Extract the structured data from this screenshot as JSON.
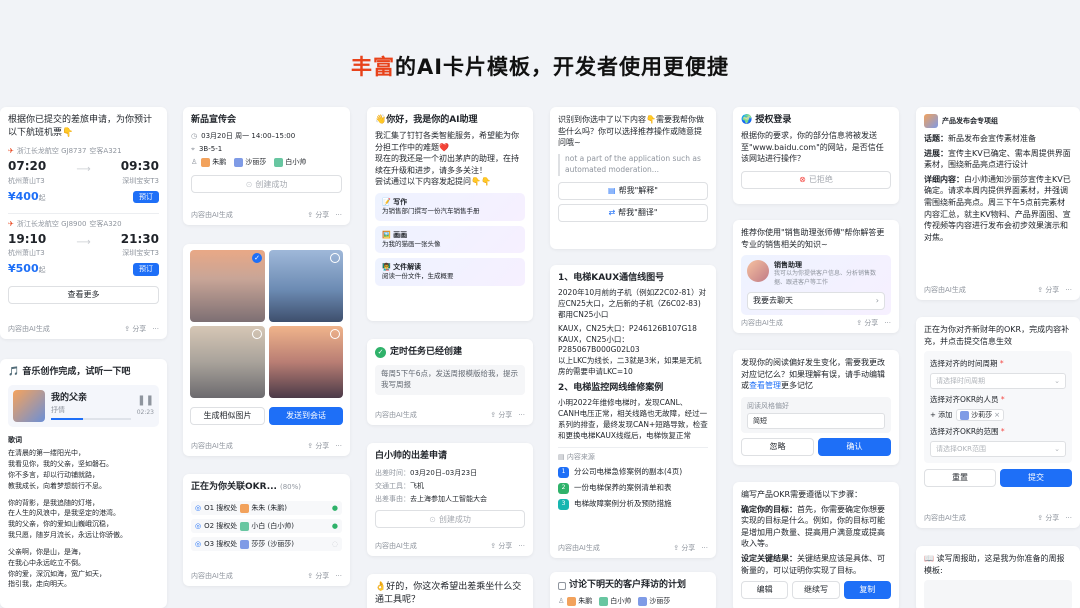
{
  "headline": {
    "highlight": "丰富",
    "rest": "的AI卡片模板，开发者使用更便捷"
  },
  "footer": {
    "src": "内容由AI生成",
    "share": "分享",
    "more": "···"
  },
  "travel": {
    "question": "根据你已提交的差旅申请，为你预计以下航班机票👇",
    "flights": [
      {
        "airline": "浙江长龙航空 GJ8737",
        "plane": "空客A321",
        "dep_time": "07:20",
        "arr_time": "09:30",
        "dep_airport": "杭州萧山T3",
        "arr_airport": "深圳宝安T3",
        "price": "¥400",
        "price_note": "起",
        "action": "预订"
      },
      {
        "airline": "浙江长龙航空 GJ8900",
        "plane": "空客A320",
        "dep_time": "19:10",
        "arr_time": "21:30",
        "dep_airport": "杭州萧山T3",
        "arr_airport": "深圳宝安T3",
        "price": "¥500",
        "price_note": "起",
        "action": "预订"
      }
    ],
    "more": "查看更多"
  },
  "music": {
    "title": "🎵 音乐创作完成，试听一下吧",
    "song": "我的父亲",
    "artist": "抒情",
    "elapsed": "00:00",
    "total": "02:23",
    "lyrics_title": "歌词",
    "lyrics": [
      "在清晨的第一缕阳光中，",
      "我看见你，我的父亲，坚如磐石。",
      "你不多言，却以行动铺就路，",
      "教我成长，向着梦想前行不息。",
      "",
      "你的背影，是我追随的灯塔，",
      "在人生的风浪中，是我坚定的港湾。",
      "我的父亲，你的爱如山巍峨沉稳，",
      "我只愿，随岁月流长，永远让你骄傲。",
      "",
      "父亲啊，你是山，是海，",
      "在我心中永远屹立不倒。",
      "你的爱，深沉如海，宽广如天，",
      "指引我，走向明天。"
    ]
  },
  "meeting": {
    "title": "新品宣传会",
    "time": "03月20日 周一 14:00–15:00",
    "room": "3B-5-1",
    "people": [
      "朱鹏",
      "沙丽莎",
      "白小帅"
    ],
    "status": "创建成功"
  },
  "images": {
    "btn_generate": "生成相似图片",
    "btn_send": "发送到会话"
  },
  "okr_link": {
    "title": "正在为你关联OKR...",
    "progress": "(80%)",
    "rows": [
      {
        "title": "O1 搜权处",
        "owner": "朱朱 (朱鹏)",
        "state": "done"
      },
      {
        "title": "O2 搜权处",
        "owner": "小白 (白小帅)",
        "state": "done"
      },
      {
        "title": "O3 搜权处",
        "owner": "莎莎 (沙丽莎)",
        "state": "loading"
      }
    ]
  },
  "assistant": {
    "greeting": "👋你好，我是你的AI助理",
    "intro": "我汇集了钉钉各类智能服务，希望能为你分担工作中的难题❤️",
    "intro2": "现在的我还是一个初出茅庐的助理，在持续在升级和进步，请多多关注！",
    "intro3": "尝试通过以下内容发起提问👇👇",
    "items": [
      {
        "icon": "📝",
        "title": "写作",
        "desc": "为销售部门撰写一份汽车销售手册"
      },
      {
        "icon": "🖼️",
        "title": "画画",
        "desc": "为我的猫画一张头像"
      },
      {
        "icon": "👨‍🏫",
        "title": "文件解读",
        "desc": "阅读一份文件，生成概要"
      }
    ]
  },
  "task": {
    "title": "定时任务已经创建",
    "desc": "每周5下午6点，发送周报模版给我，提示我写周报"
  },
  "trip": {
    "title": "白小帅的出差申请",
    "rows": [
      {
        "k": "出差时间：",
        "v": "03月20日–03月23日"
      },
      {
        "k": "交通工具：",
        "v": "飞机"
      },
      {
        "k": "出差事由：",
        "v": "去上海参加人工智能大会"
      }
    ],
    "status": "创建成功"
  },
  "transport": {
    "text": "👌好的，你这次希望出差乘坐什么交通工具呢？"
  },
  "recognize": {
    "text": "识别到你选中了以下内容👇需要我帮你做些什么吗？你可以选择推荐操作或随意提问哦~",
    "quote": "not a part of the application such as automated moderation...",
    "actions": [
      "帮我\"解释\"",
      "帮我\"翻译\""
    ]
  },
  "fault": {
    "h1": "1、电梯KAUX通信线图号",
    "p1": "2020年10月前的子机（例如Z2C02-81）对应CN25大口，之后新的子机（Z6C02-83)都用CN25小口",
    "p2": "KAUX，CN25大口：P246126B107G18",
    "p3": "KAUX，CN25小口：P285067B000G02L03",
    "p4": "以上LKC为线长，二3就是3米，如果是无机房的需要申请LKC=10",
    "h2": "2、电梯监控网线维修案例",
    "p5": "小明2022年维修电梯时，发现CANL、CANH电压正常，相关线路也无故障，经过一系列的排查，最终发现CAN+短路导致，检查和更换电梯KAUX线缆后，电梯恢复正常",
    "sources_title": "内容来源",
    "sources": [
      "分公司电梯急修案例的副本(4页)",
      "一份电梯保养的案例清单和表",
      "电梯故障案例分析及预防措施"
    ]
  },
  "plan": {
    "title": "讨论下明天的客户拜访的计划",
    "people": [
      "朱鹏",
      "白小帅",
      "沙丽莎"
    ]
  },
  "auth": {
    "title": "🌍 授权登录",
    "text": "根据你的要求，你的部分信息将被发送至\"www.baidu.com\"的网站，是否信任该网站进行操作？",
    "status": "已拒绝"
  },
  "sales": {
    "text": "推荐你使用\"销售助理张师傅\"帮你解答更专业的销售相关的知识~",
    "name": "销售助理",
    "desc": "我可以为你提供客户信息、分析销售数据、跟进客户等工作",
    "cta": "我要去聊天"
  },
  "reading": {
    "text": "发现你的阅读偏好发生变化，需要我更改对应记忆么？如果理解有误，请手动编辑或",
    "link": "查看管理",
    "text2": "更多记忆",
    "label": "阅读风格偏好",
    "value": "简短",
    "ignore": "忽略",
    "confirm": "确认"
  },
  "okr_steps": {
    "intro": "编写产品OKR需要遵循以下步骤：",
    "s1k": "确定你的目标：",
    "s1": "首先，你需要确定你想要实现的目标是什么。例如，你的目标可能是增加用户数量、提高用户满意度或提高收入等。",
    "s2k": "设定关键结果：",
    "s2": "关键结果应该是具体、可衡量的，可以证明你实现了目标。",
    "actions": [
      "编辑",
      "继续写",
      "复制"
    ]
  },
  "group": {
    "name": "产品发布会专项组",
    "topic_k": "话题：",
    "topic": "新品发布会宣传素材准备",
    "progress_k": "进展：",
    "progress": "宣传主KV已确定、需本周提供界面素材，围绕新品亮点进行设计",
    "detail_k": "详细内容：",
    "detail": "白小帅通知沙丽莎宣传主KV已确定。请求本周内提供界面素材，并强调需围绕新品亮点。周三下午5点前完素材内容汇总，就主KV物料、产品界面图、宣传视频等内容进行发布会初步效果演示和对焦。"
  },
  "okr_form": {
    "title": "正在为你对齐新财年的OKR，完成内容补充，并点击提交信息生效",
    "period_label": "选择对齐的时间周期",
    "period_ph": "请选择时间周期",
    "people_label": "选择对齐OKR的人员",
    "add": "+ 添加",
    "person": "沙莉莎",
    "range_label": "选择对齐OKR的范围",
    "range_ph": "请选择OKR范围",
    "reset": "重置",
    "submit": "提交"
  },
  "weekly": {
    "text": "📖 读写周报助，这是我为你准备的周报模板:"
  }
}
